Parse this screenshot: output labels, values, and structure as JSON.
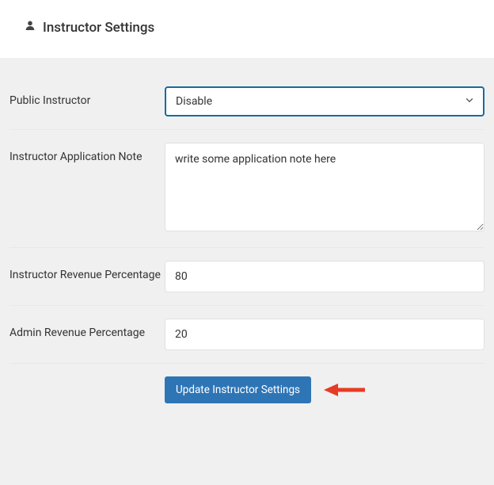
{
  "card": {
    "title": "Instructor Settings"
  },
  "form": {
    "public_instructor": {
      "label": "Public Instructor",
      "value": "Disable"
    },
    "application_note": {
      "label": "Instructor Application Note",
      "value": "write some application note here"
    },
    "instructor_revenue": {
      "label": "Instructor Revenue Percentage",
      "value": "80"
    },
    "admin_revenue": {
      "label": "Admin Revenue Percentage",
      "value": "20"
    },
    "submit_label": "Update Instructor Settings"
  },
  "icons": {
    "user": "user-icon",
    "chevron_down": "chevron-down-icon"
  },
  "annotation": {
    "color": "#e63b24"
  }
}
